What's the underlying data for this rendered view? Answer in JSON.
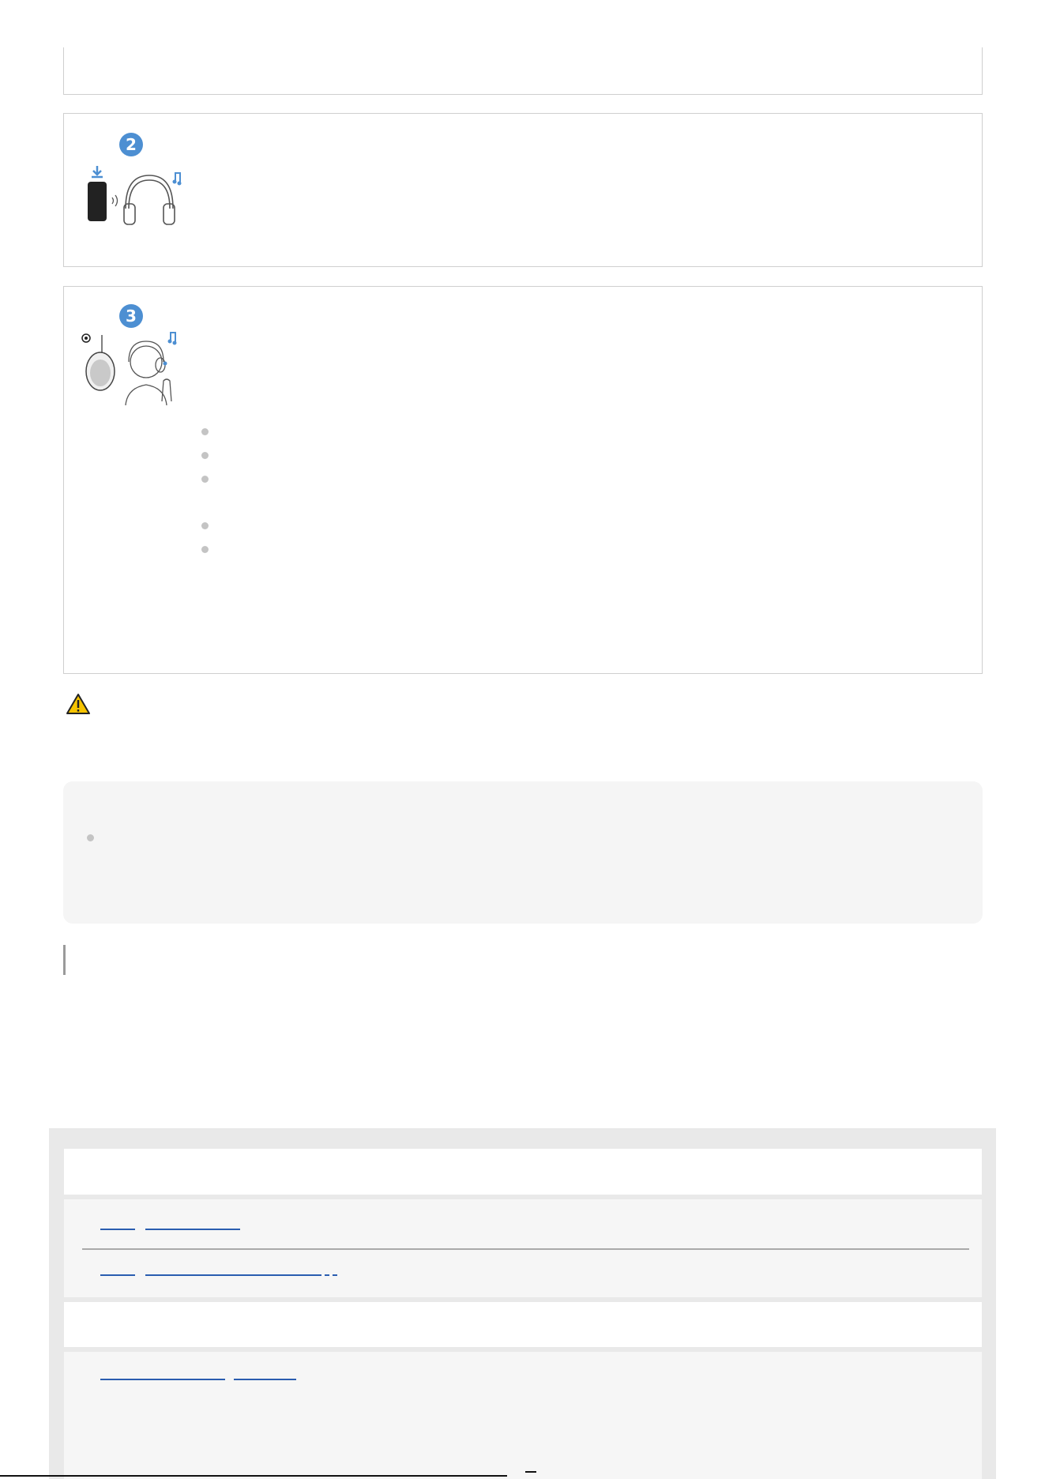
{
  "steps": [
    {
      "number": "2",
      "illustration": "smartphone-to-headphones-music"
    },
    {
      "number": "3",
      "illustration": "headphone-earcup-and-listener-touch-control"
    }
  ],
  "icons": {
    "warning": "warning-triangle-icon",
    "download": "download-arrow-icon",
    "music": "music-note-icon",
    "signal": "wireless-signal-icon"
  },
  "colors": {
    "accent": "#4d8fd2",
    "link": "#2a5db0",
    "warning_yellow": "#f5c300"
  }
}
